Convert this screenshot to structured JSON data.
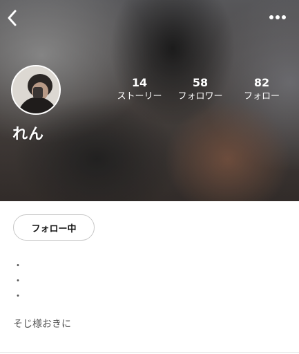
{
  "header": {
    "back_icon": "chevron-left-icon",
    "more_icon": "ellipsis-horizontal-icon"
  },
  "profile": {
    "name": "れん",
    "stats": [
      {
        "value": "14",
        "label": "ストーリー"
      },
      {
        "value": "58",
        "label": "フォロワー"
      },
      {
        "value": "82",
        "label": "フォロー"
      }
    ]
  },
  "actions": {
    "follow_label": "フォロー中"
  },
  "bio": {
    "dots": [
      "・",
      "・",
      "・"
    ],
    "text": "そじ様おきに"
  },
  "colors": {
    "hero_text": "#ffffff",
    "button_border": "#c8c8c8",
    "bio_text": "#555555"
  }
}
